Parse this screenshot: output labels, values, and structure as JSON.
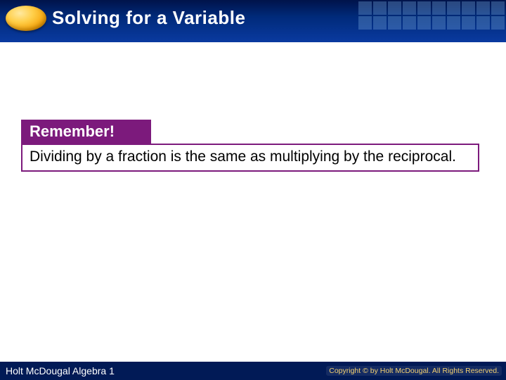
{
  "header": {
    "title": "Solving for a Variable"
  },
  "callout": {
    "label": "Remember!",
    "body": "Dividing by a fraction is the same as multiplying by the reciprocal."
  },
  "footer": {
    "left": "Holt McDougal Algebra 1",
    "right": "Copyright © by Holt McDougal. All Rights Reserved."
  }
}
